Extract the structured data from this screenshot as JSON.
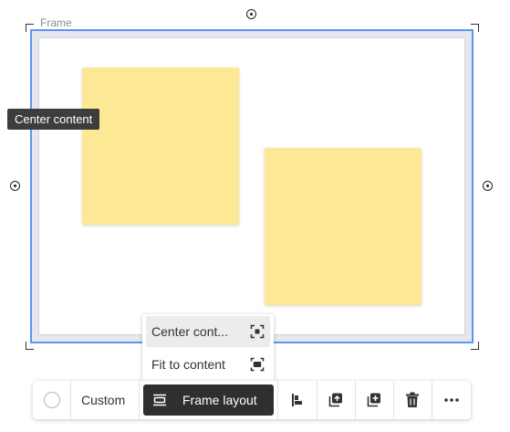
{
  "frame": {
    "label": "Frame"
  },
  "tooltip": {
    "text": "Center content"
  },
  "dropdown": {
    "items": [
      {
        "label": "Center cont...",
        "icon": "center-content-icon",
        "selected": true
      },
      {
        "label": "Fit to content",
        "icon": "fit-to-content-icon",
        "selected": false
      }
    ]
  },
  "toolbar": {
    "color_swatch": "#ffffff",
    "size_label": "Custom",
    "frame_layout_label": "Frame layout",
    "frame_layout_icon": "frame-layout-icon",
    "buttons": [
      {
        "icon": "align-icon"
      },
      {
        "icon": "bring-to-front-icon"
      },
      {
        "icon": "duplicate-icon"
      },
      {
        "icon": "trash-icon"
      },
      {
        "icon": "more-icon"
      }
    ]
  },
  "colors": {
    "selection": "#5a97ee",
    "sticky_note": "#fde995",
    "tooltip_bg": "#3d3d3d",
    "active_button_bg": "#2f2f2f"
  }
}
